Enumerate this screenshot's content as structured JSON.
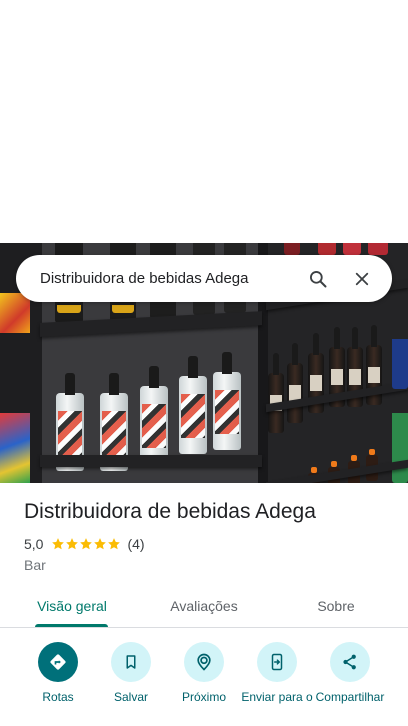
{
  "search": {
    "query": "Distribuidora de bebidas Adega"
  },
  "place": {
    "name": "Distribuidora de bebidas Adega",
    "rating": "5,0",
    "stars": 5,
    "review_count": "(4)",
    "category": "Bar"
  },
  "tabs": [
    {
      "label": "Visão geral",
      "active": true
    },
    {
      "label": "Avaliações",
      "active": false
    },
    {
      "label": "Sobre",
      "active": false
    }
  ],
  "actions": [
    {
      "label": "Rotas",
      "icon": "directions-icon"
    },
    {
      "label": "Salvar",
      "icon": "bookmark-icon"
    },
    {
      "label": "Próximo",
      "icon": "nearby-icon"
    },
    {
      "label": "Enviar para o",
      "icon": "send-to-phone-icon"
    },
    {
      "label": "Compartilhar",
      "icon": "share-icon"
    }
  ],
  "colors": {
    "accent": "#00796b",
    "primary_button": "#00707a",
    "action_bg": "#d2f4f8",
    "star": "#fbbc04"
  }
}
